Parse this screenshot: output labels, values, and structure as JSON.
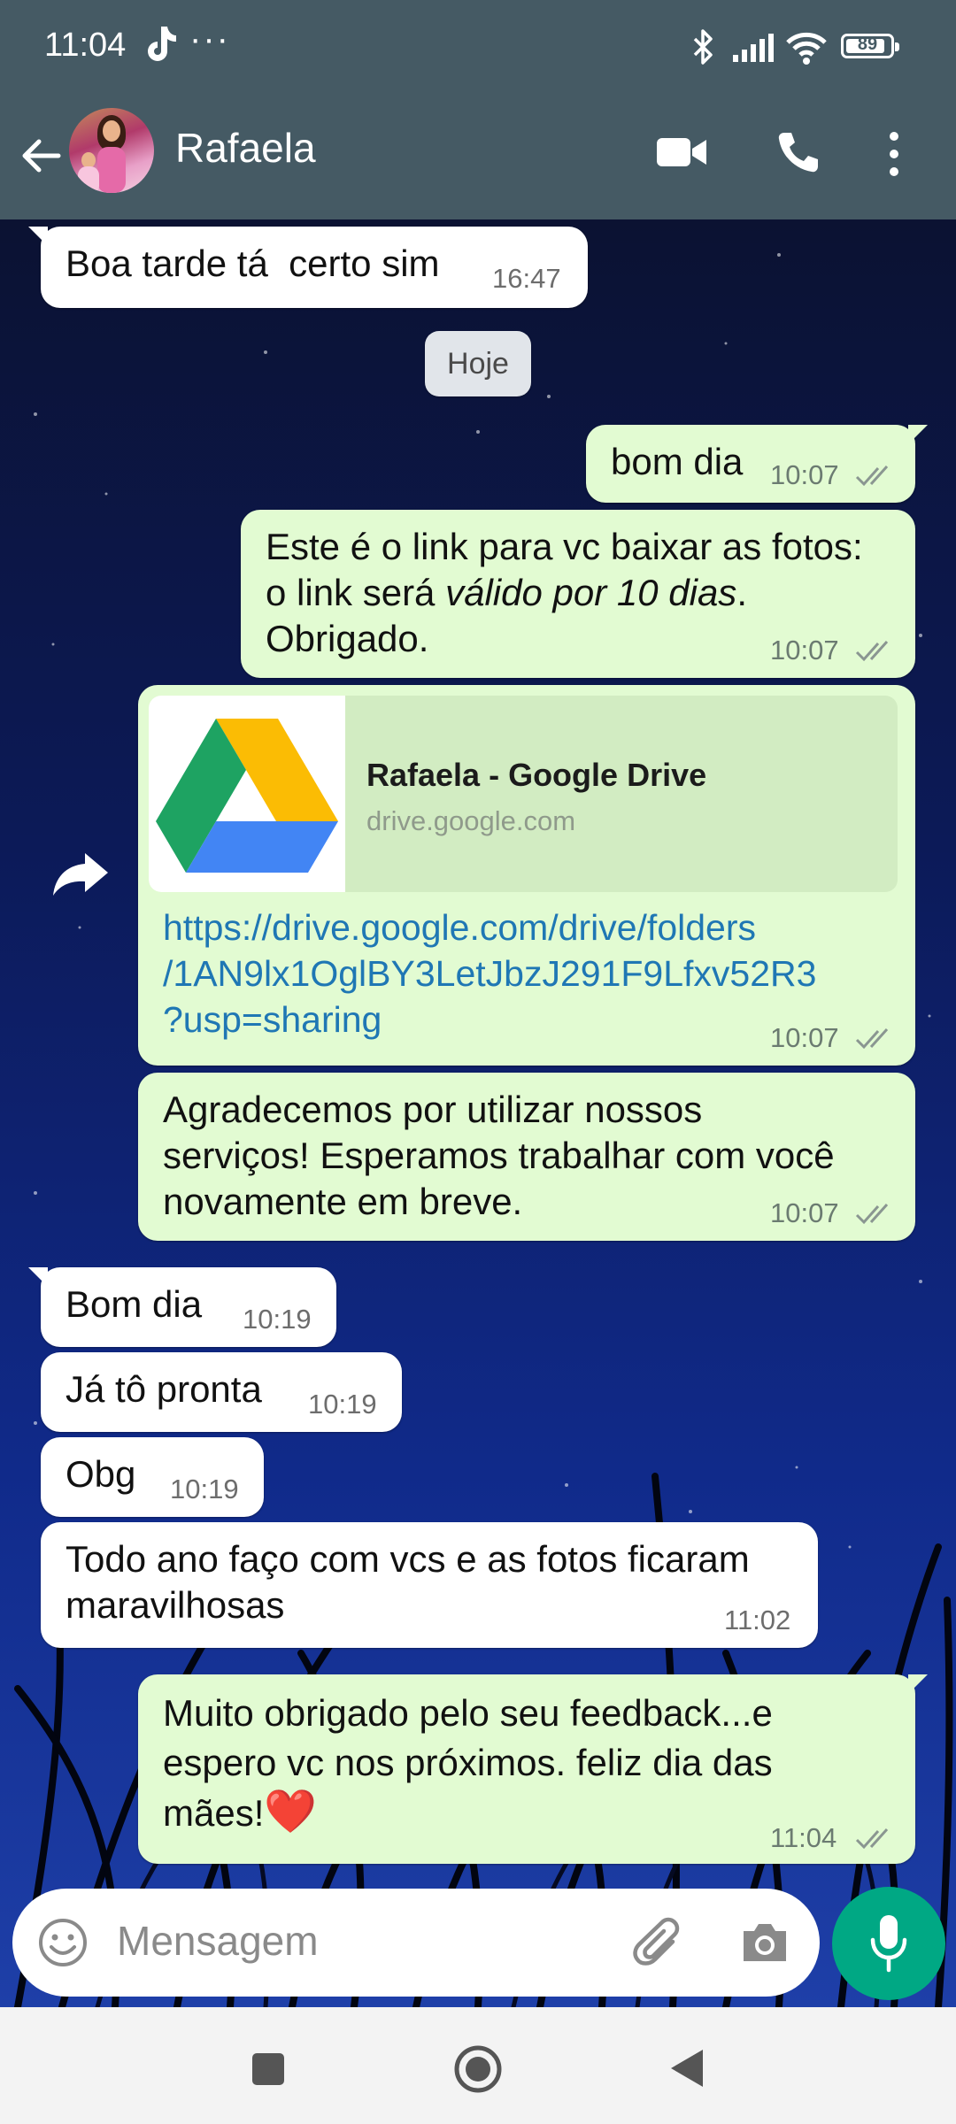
{
  "status_bar": {
    "time": "11:04",
    "more": "···",
    "battery": "89"
  },
  "header": {
    "contact_name": "Rafaela"
  },
  "day_separator": "Hoje",
  "messages": [
    {
      "direction": "in",
      "text": "Boa tarde tá  certo sim",
      "time": "16:47"
    },
    {
      "direction": "out",
      "text": "bom dia",
      "time": "10:07",
      "status": "read"
    },
    {
      "direction": "out",
      "line1": "Este é o link para vc baixar as fotos:",
      "line2_a": "o link será ",
      "line2_italic": "válido por 10 dias",
      "line2_b": ".",
      "line3": "Obrigado.",
      "time": "10:07",
      "status": "read"
    },
    {
      "direction": "out",
      "link_title": "Rafaela - Google Drive",
      "link_domain": "drive.google.com",
      "url": "https://drive.google.com/drive/folders\n/1AN9lx1OglBY3LetJbzJ291F9Lfxv52R3\n?usp=sharing",
      "time": "10:07",
      "status": "read"
    },
    {
      "direction": "out",
      "text": "Agradecemos por utilizar nossos\nserviços! Esperamos trabalhar com você\nnovamente em breve.",
      "time": "10:07",
      "status": "read"
    },
    {
      "direction": "in",
      "text": "Bom dia",
      "time": "10:19"
    },
    {
      "direction": "in",
      "text": "Já tô pronta",
      "time": "10:19"
    },
    {
      "direction": "in",
      "text": "Obg",
      "time": "10:19"
    },
    {
      "direction": "in",
      "text": "Todo ano faço com vcs e as fotos ficaram\nmaravilhosas",
      "time": "11:02"
    },
    {
      "direction": "out",
      "text": "Muito obrigado pelo seu feedback...e\nespero vc nos próximos. feliz dia das\nmães!",
      "emoji": "❤️",
      "time": "11:04",
      "status": "read"
    }
  ],
  "input": {
    "placeholder": "Mensagem"
  },
  "colors": {
    "header": "#455a64",
    "outgoing_bubble": "#e2fbd2",
    "incoming_bubble": "#ffffff",
    "link": "#1f77b4",
    "mic_button": "#00a884"
  },
  "icons": [
    "back-arrow-icon",
    "video-call-icon",
    "voice-call-icon",
    "menu-icon",
    "forward-icon",
    "emoji-icon",
    "attach-icon",
    "camera-icon",
    "mic-icon",
    "double-check-icon"
  ]
}
